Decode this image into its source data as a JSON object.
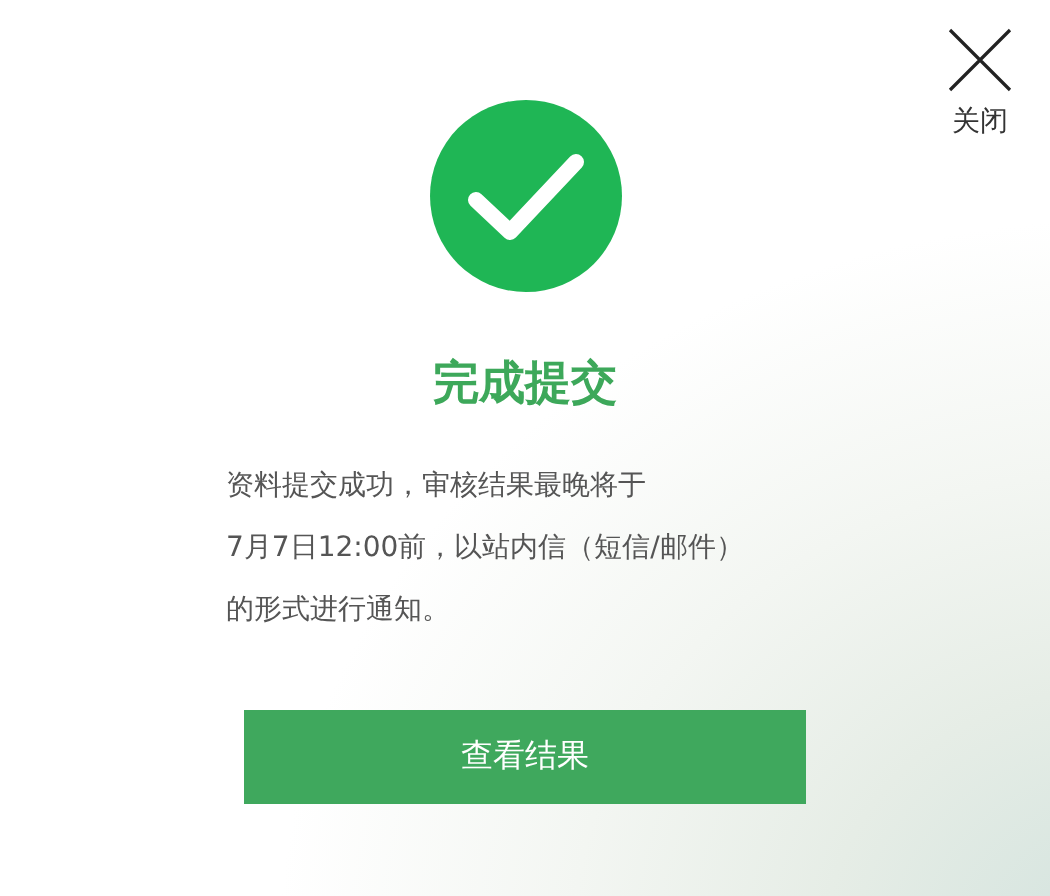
{
  "close_button": {
    "label": "关闭"
  },
  "title": "完成提交",
  "message_lines": [
    "资料提交成功，审核结果最晚将于",
    "7月7日12:00前，以站内信（短信/邮件）",
    "的形式进行通知。"
  ],
  "primary_button": {
    "label": "查看结果"
  }
}
